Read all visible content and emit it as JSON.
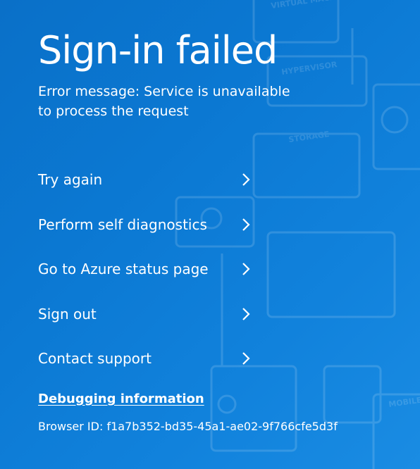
{
  "page": {
    "title": "Sign-in failed",
    "error_message": "Error message: Service is unavailable to process the request",
    "actions": [
      {
        "label": "Try again",
        "icon": "chevron-right-icon"
      },
      {
        "label": "Perform self diagnostics",
        "icon": "chevron-right-icon"
      },
      {
        "label": "Go to Azure status page",
        "icon": "chevron-right-icon"
      },
      {
        "label": "Sign out",
        "icon": "chevron-right-icon"
      },
      {
        "label": "Contact support",
        "icon": "chevron-right-icon"
      }
    ],
    "debug_link": "Debugging information",
    "browser_id": "Browser ID: f1a7b352-bd35-45a1-ae02-9f766cfe5d3f"
  },
  "background": {
    "labels": [
      "VIRTUAL MACHINES",
      "HYPERVISOR",
      "STORAGE",
      "MOBILE"
    ],
    "colors": {
      "primary": "#0b78d2",
      "text": "#ffffff"
    }
  }
}
